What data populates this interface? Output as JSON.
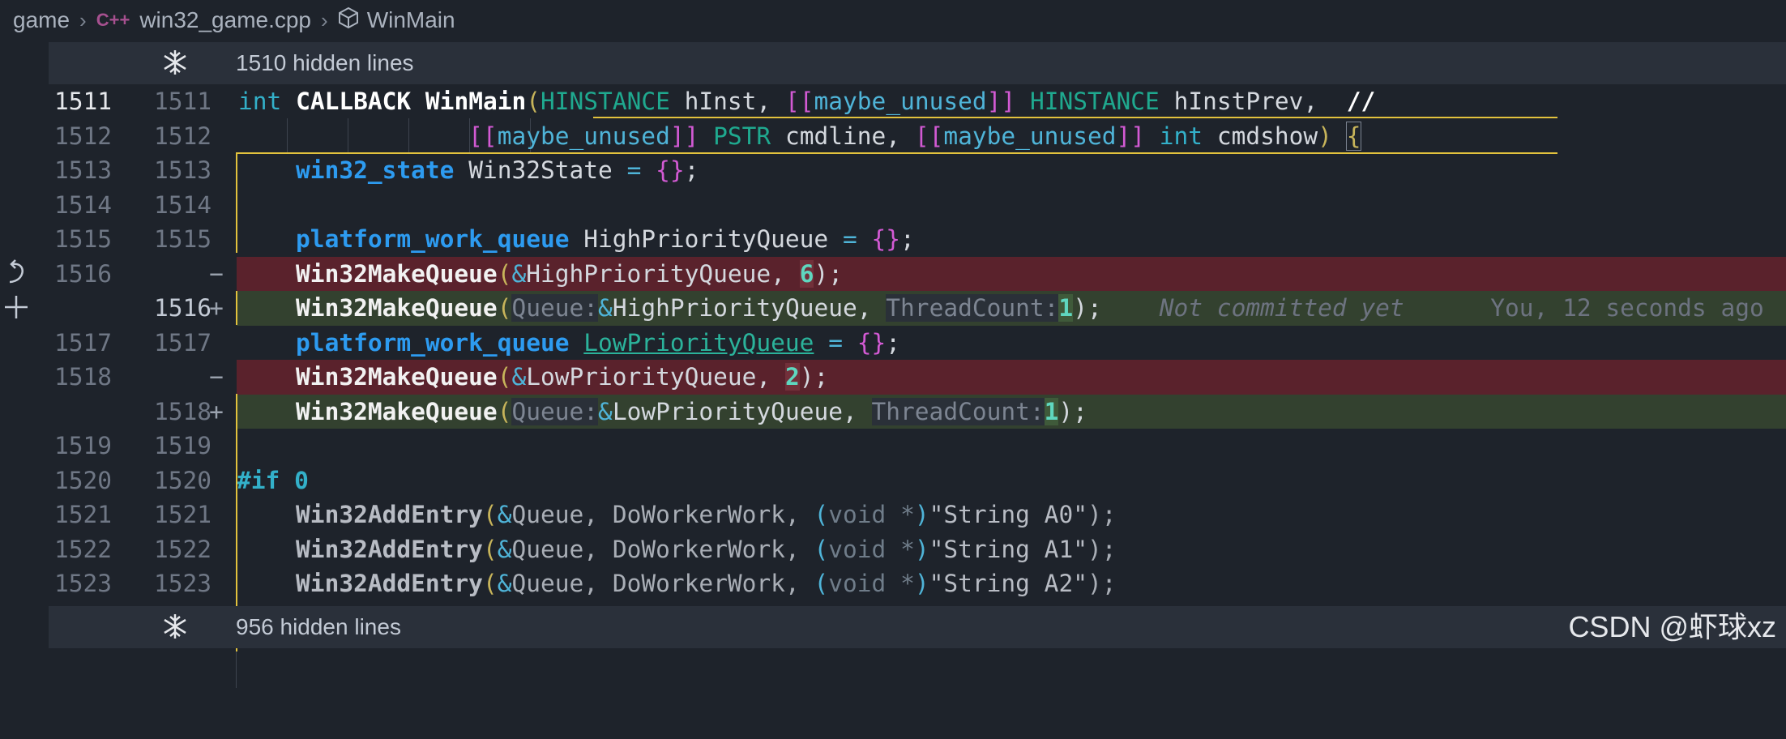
{
  "breadcrumb": {
    "folder": "game",
    "file_icon": "C++",
    "file": "win32_game.cpp",
    "symbol": "WinMain"
  },
  "fold_top": {
    "label": "1510 hidden lines"
  },
  "fold_bottom": {
    "label": "956 hidden lines"
  },
  "rows": [
    {
      "old": "1511",
      "new": "1511",
      "marker": ""
    },
    {
      "old": "1512",
      "new": "1512",
      "marker": ""
    },
    {
      "old": "1513",
      "new": "1513",
      "marker": ""
    },
    {
      "old": "1514",
      "new": "1514",
      "marker": ""
    },
    {
      "old": "1515",
      "new": "1515",
      "marker": ""
    },
    {
      "old": "1516",
      "new": "",
      "marker": "−"
    },
    {
      "old": "",
      "new": "1516",
      "marker": "+"
    },
    {
      "old": "1517",
      "new": "1517",
      "marker": ""
    },
    {
      "old": "1518",
      "new": "",
      "marker": "−"
    },
    {
      "old": "",
      "new": "1518",
      "marker": "+"
    },
    {
      "old": "1519",
      "new": "1519",
      "marker": ""
    },
    {
      "old": "1520",
      "new": "1520",
      "marker": ""
    },
    {
      "old": "1521",
      "new": "1521",
      "marker": ""
    },
    {
      "old": "1522",
      "new": "1522",
      "marker": ""
    },
    {
      "old": "1523",
      "new": "1523",
      "marker": ""
    }
  ],
  "code": {
    "l1511": {
      "int": "int",
      "callback": "CALLBACK",
      "winmain": "WinMain",
      "paren": "(",
      "hinstance1": "HINSTANCE",
      "hinst": "hInst",
      "comma1": ",",
      "attr1_open": "[[",
      "maybe1": "maybe_unused",
      "attr1_close": "]]",
      "hinstance2": "HINSTANCE",
      "hinstprev": "hInstPrev",
      "comma2": ",",
      "comment": "//"
    },
    "l1512": {
      "attr_open": "[[",
      "maybe": "maybe_unused",
      "attr_close": "]]",
      "pstr": "PSTR",
      "cmdline": "cmdline",
      "comma": ",",
      "attr2_open": "[[",
      "maybe2": "maybe_unused",
      "attr2_close": "]]",
      "int": "int",
      "cmdshow": "cmdshow",
      "close_paren": ")",
      "brace": "{"
    },
    "l1513": {
      "type": "win32_state",
      "name": "Win32State",
      "eq": "=",
      "braces": "{}",
      "semi": ";"
    },
    "l1515": {
      "type": "platform_work_queue",
      "name": "HighPriorityQueue",
      "eq": "=",
      "braces": "{}",
      "semi": ";"
    },
    "l1516_del": {
      "fn": "Win32MakeQueue",
      "paren": "(",
      "amp": "&",
      "arg": "HighPriorityQueue",
      "comma": ",",
      "num": "6",
      "end": ");"
    },
    "l1516_ins": {
      "fn": "Win32MakeQueue",
      "paren": "(",
      "hint1": "Queue:",
      "amp": "&",
      "arg": "HighPriorityQueue",
      "comma": ",",
      "hint2": "ThreadCount:",
      "num": "1",
      "end": ");",
      "blame": "Not committed yet",
      "blame_author": "You, 12 seconds ago"
    },
    "l1517": {
      "type": "platform_work_queue",
      "name": "LowPriorityQueue",
      "eq": "=",
      "braces": "{}",
      "semi": ";"
    },
    "l1518_del": {
      "fn": "Win32MakeQueue",
      "paren": "(",
      "amp": "&",
      "arg": "LowPriorityQueue",
      "comma": ",",
      "num": "2",
      "end": ");"
    },
    "l1518_ins": {
      "fn": "Win32MakeQueue",
      "paren": "(",
      "hint1": "Queue:",
      "amp": "&",
      "arg": "LowPriorityQueue",
      "comma": ",",
      "hint2": "ThreadCount:",
      "num": "1",
      "end": ");"
    },
    "l1520": {
      "directive": "#if",
      "num": "0"
    },
    "l1521": {
      "fn": "Win32AddEntry",
      "paren": "(",
      "amp": "&",
      "arg": "Queue",
      "c1": ",",
      "work": "DoWorkerWork",
      "c2": ",",
      "cast_open": "(",
      "void": "void",
      "star": "*",
      "cast_close": ")",
      "str": "\"String A0\"",
      "end": ");"
    },
    "l1522": {
      "fn": "Win32AddEntry",
      "paren": "(",
      "amp": "&",
      "arg": "Queue",
      "c1": ",",
      "work": "DoWorkerWork",
      "c2": ",",
      "cast_open": "(",
      "void": "void",
      "star": "*",
      "cast_close": ")",
      "str": "\"String A1\"",
      "end": ");"
    },
    "l1523": {
      "fn": "Win32AddEntry",
      "paren": "(",
      "amp": "&",
      "arg": "Queue",
      "c1": ",",
      "work": "DoWorkerWork",
      "c2": ",",
      "cast_open": "(",
      "void": "void",
      "star": "*",
      "cast_close": ")",
      "str": "\"String A2\"",
      "end": ");"
    }
  },
  "icons": {
    "fold": "unfold-icon",
    "revert": "revert-icon",
    "add": "add-icon",
    "symbol": "cube-icon",
    "file": "cpp-file-icon"
  },
  "watermark": "CSDN @虾球xz"
}
